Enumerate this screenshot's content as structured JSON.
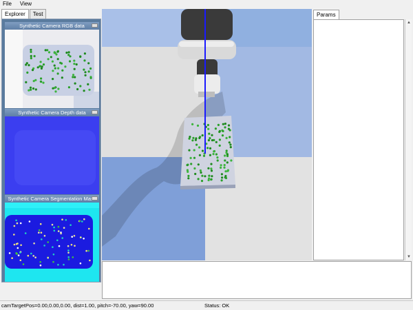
{
  "menubar": {
    "items": [
      "File",
      "View"
    ]
  },
  "left_tabs": [
    "Explorer",
    "Test"
  ],
  "camera_windows": [
    {
      "title": "Synthetic Camera RGB data"
    },
    {
      "title": "Synthetic Camera Depth data"
    },
    {
      "title": "Synthetic Camera Segmentation Mask"
    }
  ],
  "params": {
    "tab_label": "Params"
  },
  "status": {
    "cam_info": "camTargetPos=0.00,0.00,0.00, dist=1.00, pitch=-70.00, yaw=90.00",
    "state": "Status: OK"
  },
  "colors": {
    "panel_bg": "#5a7b9e",
    "depth_blue": "#3a3cf0",
    "seg_cyan": "#1ee6f0",
    "seg_blue": "#1818e0",
    "dot_green": "#2aa02a",
    "floor_blue": "#7f9fd8",
    "laser": "#1a1aff"
  }
}
